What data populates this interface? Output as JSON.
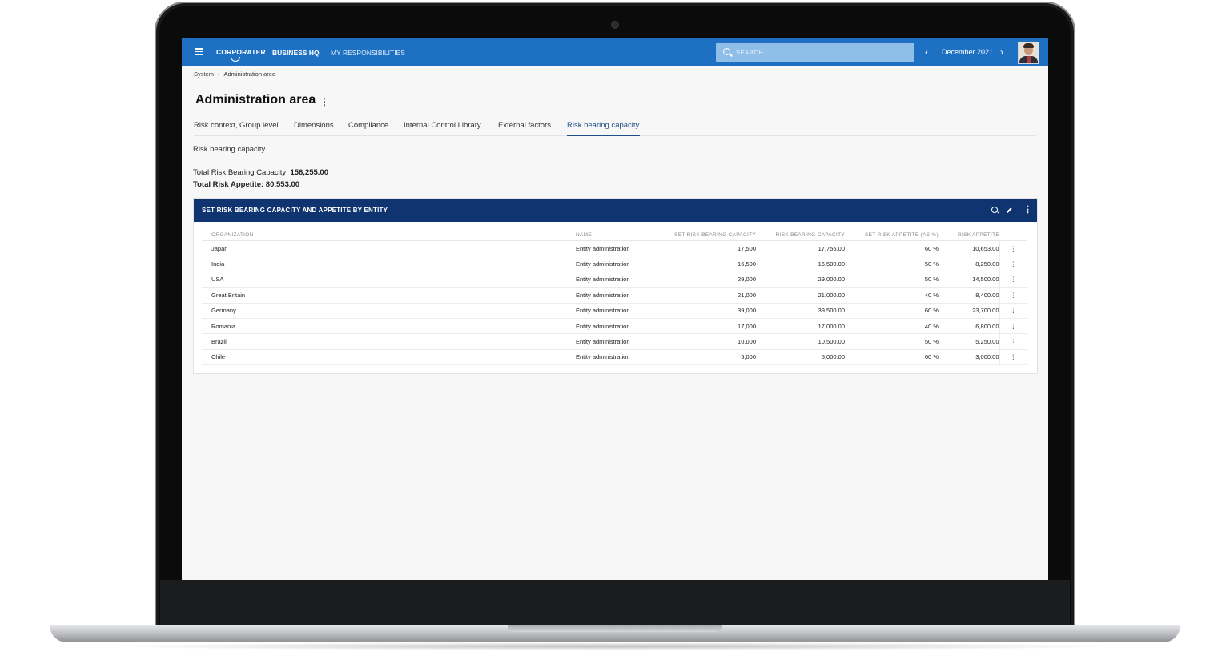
{
  "topbar": {
    "brand": "CORPORATER",
    "nav_business_hq": "BUSINESS HQ",
    "nav_my_responsibilities": "MY RESPONSIBILITIES",
    "search_placeholder": "SEARCH",
    "period": "December 2021",
    "prev_icon": "‹",
    "next_icon": "›",
    "accent_color": "#1d70c2"
  },
  "breadcrumb": {
    "items": [
      "System",
      "Administration area"
    ],
    "separator": "›"
  },
  "page": {
    "title": "Administration area",
    "kebab": "⋮",
    "tabs": [
      "Risk context, Group level",
      "Dimensions",
      "Compliance",
      "Internal Control Library",
      "External factors",
      "Risk bearing capacity"
    ],
    "active_tab": "Risk bearing capacity",
    "description": "Risk bearing capacity.",
    "total_capacity_label": "Total Risk Bearing Capacity:",
    "total_capacity_value": "156,255.00",
    "total_appetite_label": "Total Risk Appetite:",
    "total_appetite_value": "80,553.00"
  },
  "panel": {
    "title": "SET RISK BEARING CAPACITY AND APPETITE BY ENTITY",
    "header_color": "#0f3470",
    "more_icon": "⋮",
    "columns": [
      "ORGANIZATION",
      "NAME",
      "SET RISK BEARING CAPACITY",
      "RISK BEARING CAPACITY",
      "SET RISK APPETITE (AS %)",
      "RISK APPETITE"
    ],
    "rows": [
      {
        "org": "Japan",
        "name": "Entity administration",
        "set_cap": "17,500",
        "cap": "17,755.00",
        "set_app": "60 %",
        "app": "10,653.00"
      },
      {
        "org": "India",
        "name": "Entity administration",
        "set_cap": "16,500",
        "cap": "16,500.00",
        "set_app": "50 %",
        "app": "8,250.00"
      },
      {
        "org": "USA",
        "name": "Entity administration",
        "set_cap": "29,000",
        "cap": "29,000.00",
        "set_app": "50 %",
        "app": "14,500.00"
      },
      {
        "org": "Great Britain",
        "name": "Entity administration",
        "set_cap": "21,000",
        "cap": "21,000.00",
        "set_app": "40 %",
        "app": "8,400.00"
      },
      {
        "org": "Germany",
        "name": "Entity administration",
        "set_cap": "39,000",
        "cap": "39,500.00",
        "set_app": "60 %",
        "app": "23,700.00"
      },
      {
        "org": "Romania",
        "name": "Entity administration",
        "set_cap": "17,000",
        "cap": "17,000.00",
        "set_app": "40 %",
        "app": "6,800.00"
      },
      {
        "org": "Brazil",
        "name": "Entity administration",
        "set_cap": "10,000",
        "cap": "10,500.00",
        "set_app": "50 %",
        "app": "5,250.00"
      },
      {
        "org": "Chile",
        "name": "Entity administration",
        "set_cap": "5,000",
        "cap": "5,000.00",
        "set_app": "60 %",
        "app": "3,000.00"
      }
    ],
    "row_more_icon": "⋮"
  }
}
